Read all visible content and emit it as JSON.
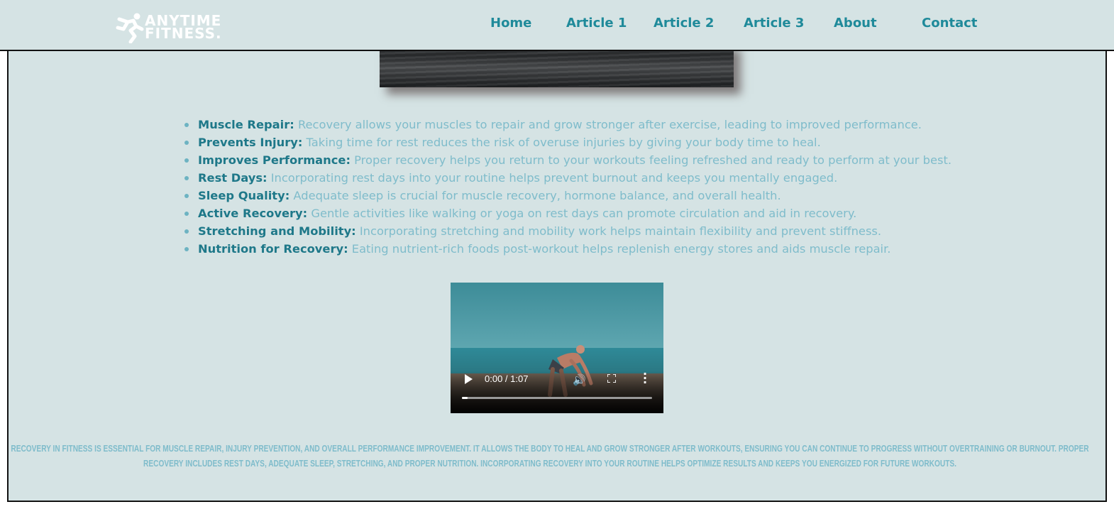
{
  "brand": {
    "line1": "ANYTIME",
    "line2": "FITNESS."
  },
  "nav": [
    "Home",
    "Article 1",
    "Article 2",
    "Article 3",
    "About",
    "Contact"
  ],
  "points": [
    {
      "title": "Muscle Repair:",
      "text": " Recovery allows your muscles to repair and grow stronger after exercise, leading to improved performance."
    },
    {
      "title": "Prevents Injury:",
      "text": " Taking time for rest reduces the risk of overuse injuries by giving your body time to heal."
    },
    {
      "title": "Improves Performance:",
      "text": " Proper recovery helps you return to your workouts feeling refreshed and ready to perform at your best."
    },
    {
      "title": "Rest Days:",
      "text": " Incorporating rest days into your routine helps prevent burnout and keeps you mentally engaged."
    },
    {
      "title": "Sleep Quality:",
      "text": " Adequate sleep is crucial for muscle recovery, hormone balance, and overall health."
    },
    {
      "title": "Active Recovery:",
      "text": " Gentle activities like walking or yoga on rest days can promote circulation and aid in recovery."
    },
    {
      "title": "Stretching and Mobility:",
      "text": " Incorporating stretching and mobility work helps maintain flexibility and prevent stiffness."
    },
    {
      "title": "Nutrition for Recovery:",
      "text": " Eating nutrient-rich foods post-workout helps replenish energy stores and aids muscle repair."
    }
  ],
  "video": {
    "time": "0:00 / 1:07",
    "progress": 0.03
  },
  "summary": "Recovery in fitness is essential for muscle repair, injury prevention, and overall performance improvement. It allows the body to heal and grow stronger after workouts, ensuring you can continue to progress without overtraining or burnout. Proper recovery includes rest days, adequate sleep, stretching, and proper nutrition. Incorporating recovery into your routine helps optimize results and keeps you energized for future workouts."
}
